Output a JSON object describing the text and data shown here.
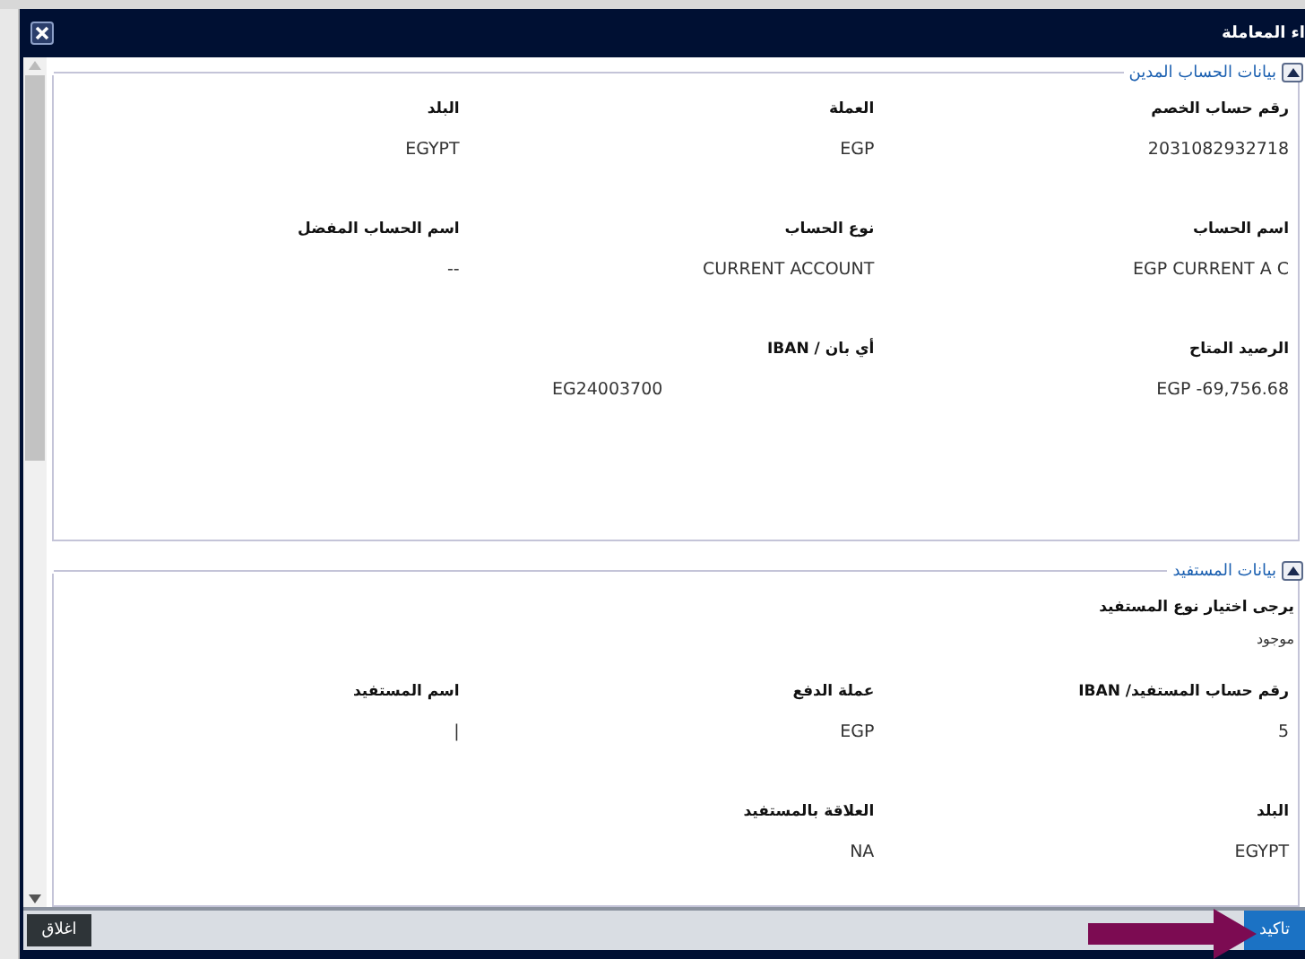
{
  "window": {
    "title": "اء المعاملة"
  },
  "sections": [
    {
      "title": "بيانات الحساب المدين",
      "expanded": true,
      "rows": [
        [
          {
            "label": "رقم حساب الخصم",
            "value": "2031082932718",
            "kind": "text"
          },
          {
            "label": "العملة",
            "value": "EGP",
            "kind": "text"
          },
          {
            "label": "البلد",
            "value": "EGYPT",
            "kind": "text"
          }
        ],
        [
          {
            "label": "اسم الحساب",
            "value": "EGP CURRENT A C",
            "kind": "text"
          },
          {
            "label": "نوع الحساب",
            "value": "CURRENT ACCOUNT",
            "kind": "text"
          },
          {
            "label": "اسم الحساب المفضل",
            "value": "--",
            "kind": "text"
          }
        ],
        [
          {
            "label": "الرصيد المتاح",
            "value": "EGP -69,756.68",
            "kind": "text"
          },
          {
            "label": "أي بان / **IBAN**",
            "value": "EG24003700",
            "kind": "iban"
          }
        ]
      ]
    },
    {
      "title": "بيانات المستفيد",
      "expanded": true,
      "rows": [
        [
          {
            "label": "يرجى اختيار نوع المستفيد",
            "value": "موجود",
            "kind": "full"
          }
        ],
        [
          {
            "label": "رقم حساب المستفيد/ **IBAN**",
            "value": "5",
            "kind": "text"
          },
          {
            "label": "عملة الدفع",
            "value": "EGP",
            "kind": "text"
          },
          {
            "label": "اسم المستفيد",
            "value": "|",
            "kind": "text"
          }
        ],
        [
          {
            "label": "البلد",
            "value": "EGYPT",
            "kind": "text"
          },
          {
            "label": "العلاقة بالمستفيد",
            "value": "NA",
            "kind": "text"
          }
        ]
      ]
    }
  ],
  "buttons": [
    {
      "label": "تاكيد",
      "kind": "primary"
    },
    {
      "label": "اغلاق",
      "kind": "secondary"
    }
  ]
}
